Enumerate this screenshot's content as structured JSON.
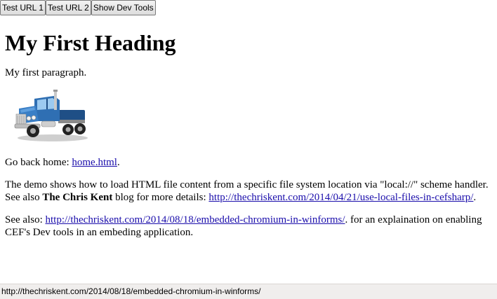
{
  "toolbar": {
    "buttons": [
      {
        "label": "Test URL 1"
      },
      {
        "label": "Test URL 2"
      },
      {
        "label": "Show Dev Tools"
      }
    ]
  },
  "page": {
    "heading": "My First Heading",
    "paragraph1": "My first paragraph.",
    "image_icon": "truck-image",
    "go_back_prefix": "Go back home: ",
    "go_back_link": "home.html",
    "go_back_suffix": ".",
    "demo_text_1": "The demo shows how to load HTML file content from a specific file system location via \"local://\" scheme handler. See also ",
    "demo_bold": "The Chris Kent",
    "demo_text_2": " blog for more details: ",
    "demo_link": "http://thechriskent.com/2014/04/21/use-local-files-in-cefsharp/",
    "demo_suffix": ".",
    "see_also_prefix": "See also: ",
    "see_also_link": "http://thechriskent.com/2014/08/18/embedded-chromium-in-winforms/",
    "see_also_suffix": ". for an explaination on enabling CEF's Dev tools in an embeding application."
  },
  "statusbar": {
    "text": "http://thechriskent.com/2014/08/18/embedded-chromium-in-winforms/"
  },
  "colors": {
    "link": "#1a0dab",
    "statusbar_bg": "#f0eeed",
    "truck_blue": "#2f6fb3"
  }
}
